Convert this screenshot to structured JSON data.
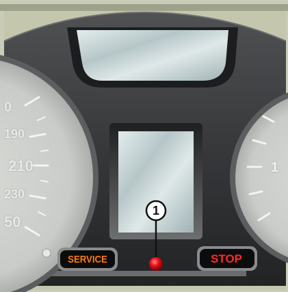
{
  "speedometer": {
    "scale_labels": [
      "0",
      "190",
      "210",
      "230",
      "50"
    ]
  },
  "right_gauge": {
    "scale_labels": [
      "1"
    ]
  },
  "buttons": {
    "service_label": "SERVICE",
    "stop_label": "STOP"
  },
  "callout": {
    "number": "1"
  },
  "colors": {
    "service_text": "#ff7a14",
    "stop_text": "#ff2a2a",
    "indicator_light": "#e8101a",
    "frame_bg": "#c9ccb6",
    "cluster_body": "#3a3b3d"
  },
  "icons": {
    "indicator": "red-warning-light-icon"
  }
}
